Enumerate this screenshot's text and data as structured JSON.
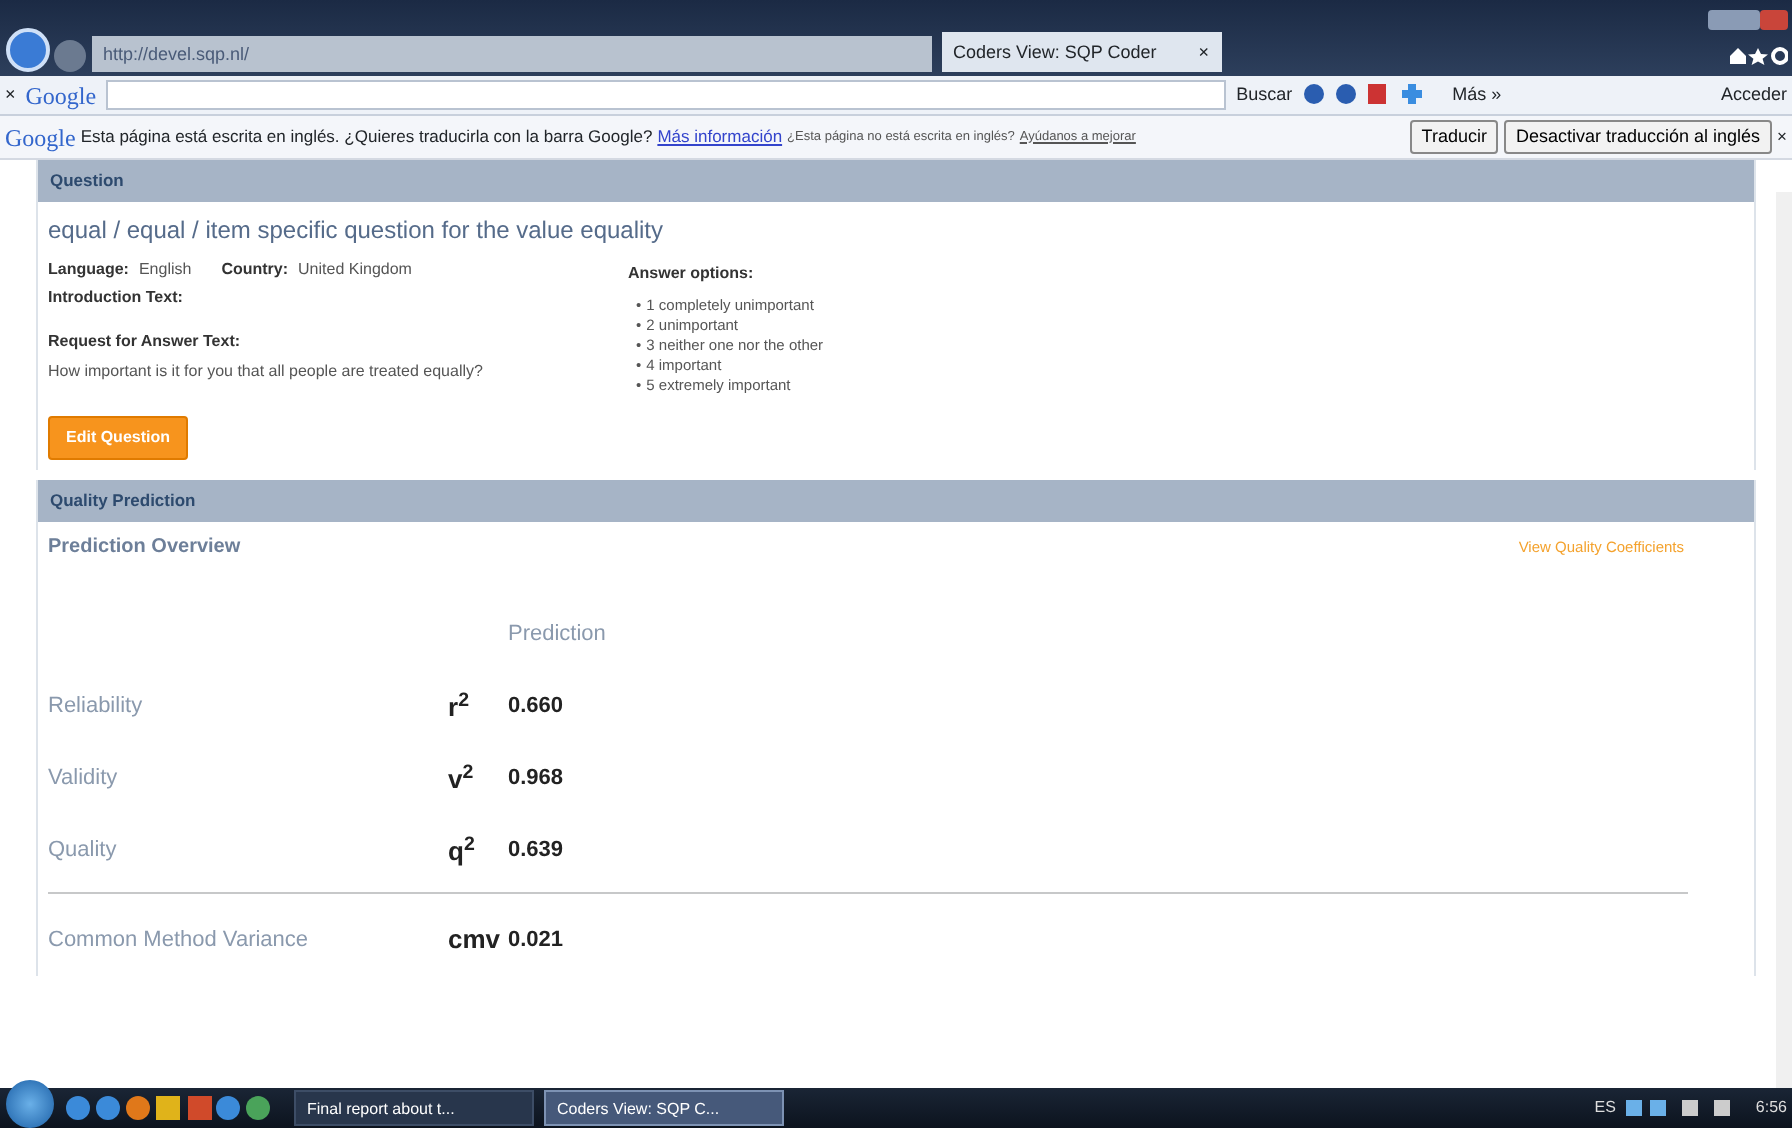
{
  "browser": {
    "address": "http://devel.sqp.nl/",
    "tab_title": "Coders View: SQP Coder",
    "tab_close": "×"
  },
  "toolbar": {
    "close": "×",
    "brand": "Google",
    "search_button": "Buscar",
    "more": "Más »",
    "sign_in": "Acceder"
  },
  "translate_bar": {
    "brand": "Google",
    "message": "Esta página está escrita en inglés. ¿Quieres traducirla con la barra Google?",
    "info_link": "Más información",
    "note": "¿Esta página no está escrita en inglés?",
    "help_link": "Ayúdanos a mejorar",
    "buttons": [
      "Traducir",
      "Desactivar traducción al inglés"
    ],
    "close": "×"
  },
  "question": {
    "header": "Question",
    "title": "equal / equal / item specific question for the value equality",
    "meta": [
      {
        "label": "Language:",
        "value": "English"
      },
      {
        "label": "Country:",
        "value": "United Kingdom"
      }
    ],
    "intro_label": "Introduction Text:",
    "request_label": "Request for Answer Text:",
    "request_text": "How important is it for you that all people are treated equally?",
    "answer_label": "Answer options:",
    "answers": [
      {
        "bullet": "•",
        "text": "1 completely unimportant"
      },
      {
        "bullet": "•",
        "text": "2 unimportant"
      },
      {
        "bullet": "•",
        "text": "3 neither one nor the other"
      },
      {
        "bullet": "•",
        "text": "4 important"
      },
      {
        "bullet": "•",
        "text": "5 extremely important"
      }
    ],
    "edit_button": "Edit Question"
  },
  "quality": {
    "header": "Quality Prediction",
    "subtitle": "Prediction Overview",
    "coefficients_link": "View Quality Coefficients",
    "column_header": "Prediction",
    "rows": [
      {
        "label": "Reliability",
        "symbol": "r$^{2}$",
        "value": "0.660"
      },
      {
        "label": "Validity",
        "symbol": "v$^{2}$",
        "value": "0.968"
      },
      {
        "label": "Quality",
        "symbol": "q$^{2}$",
        "value": "0.639"
      }
    ],
    "cmv": {
      "label": "Common Method Variance",
      "symbol": "cmv",
      "value": "0.021"
    }
  },
  "taskbar": {
    "windows": [
      {
        "title": "Final report about t...",
        "selected": false
      },
      {
        "title": "Coders View: SQP C...",
        "selected": true
      }
    ],
    "language": "ES",
    "clock": "6:56"
  }
}
